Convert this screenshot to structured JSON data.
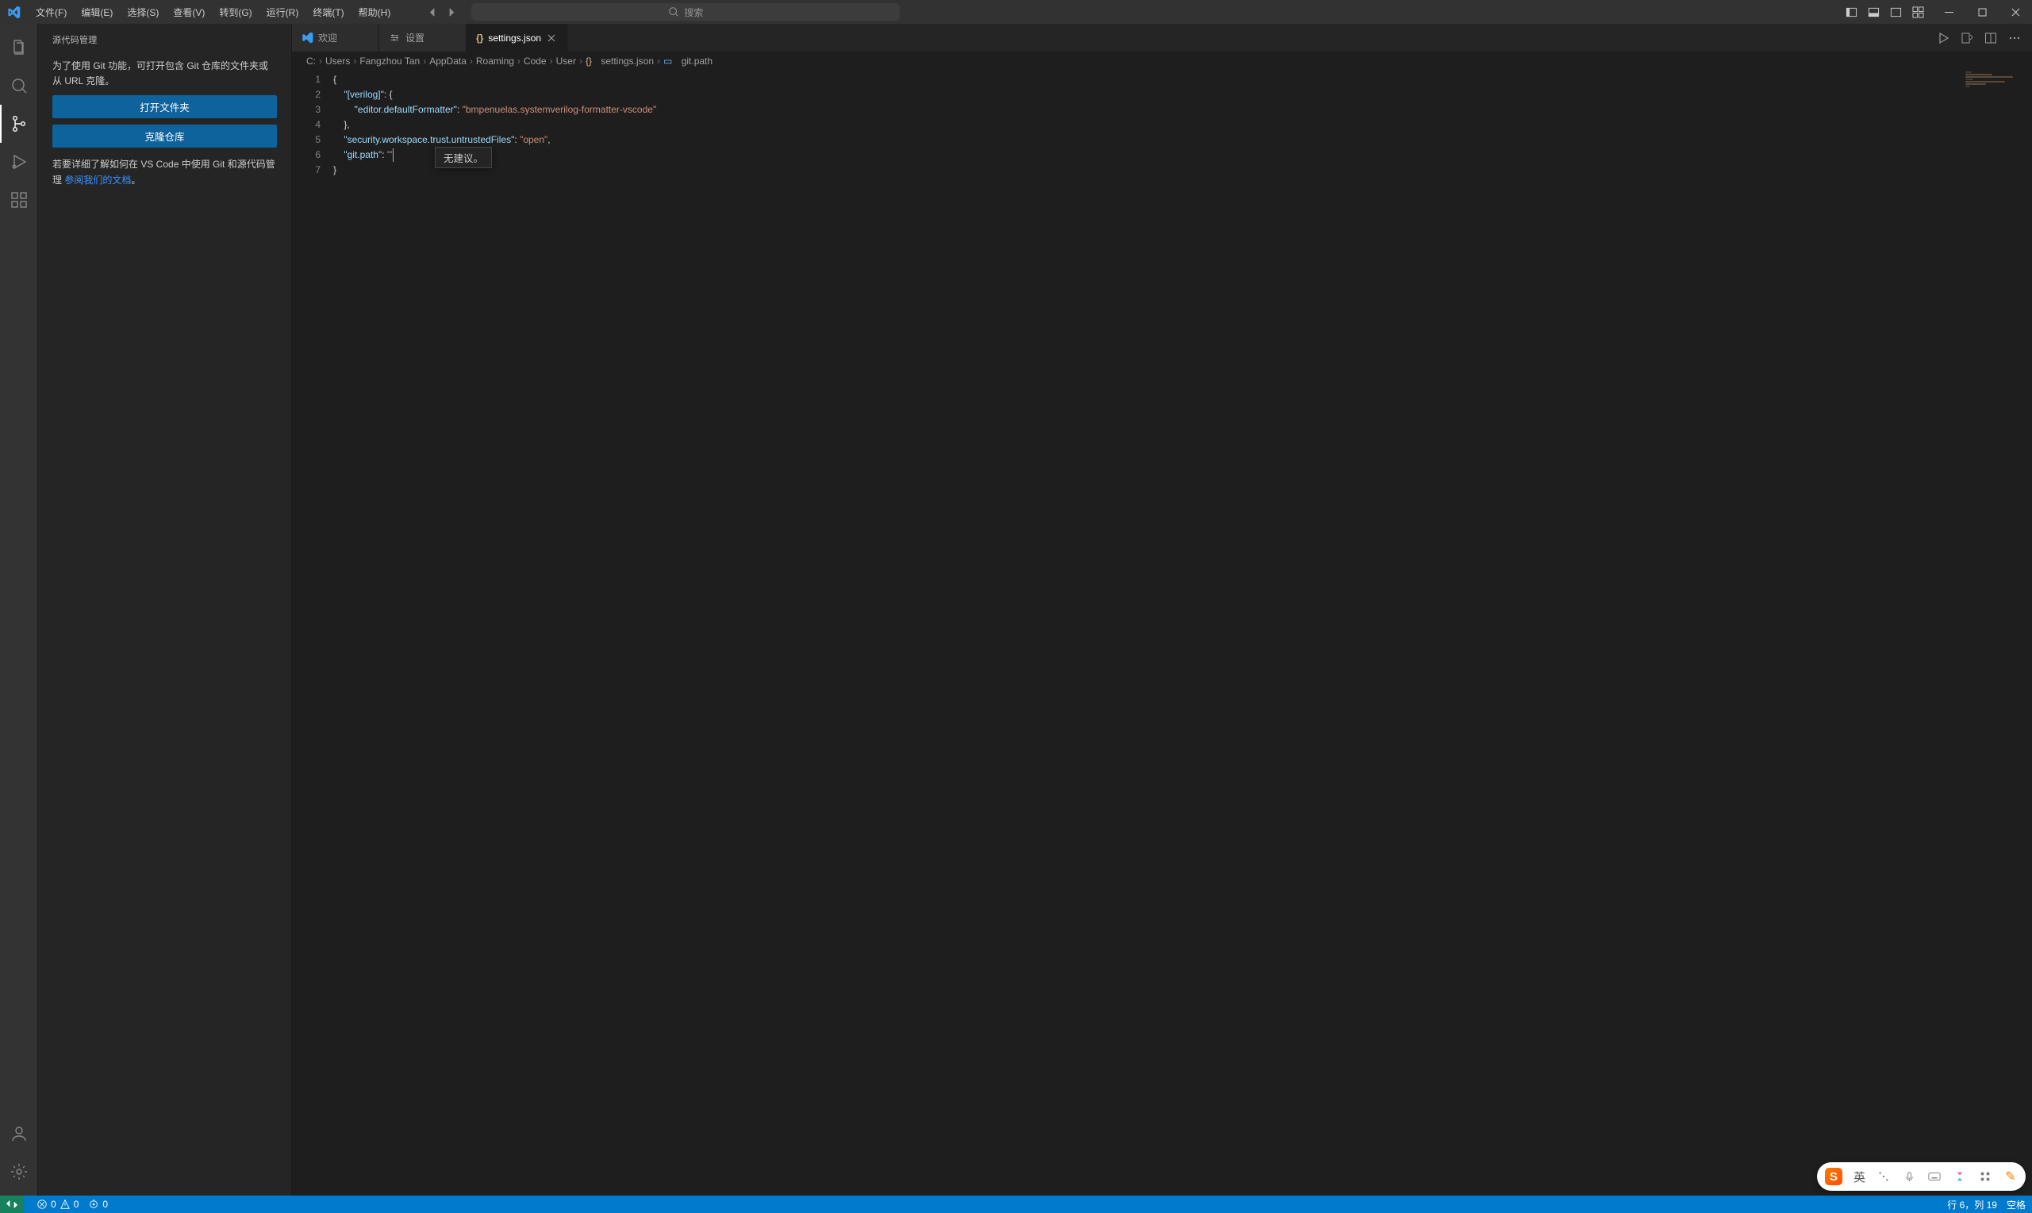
{
  "menubar": {
    "items": [
      "文件(F)",
      "编辑(E)",
      "选择(S)",
      "查看(V)",
      "转到(G)",
      "运行(R)",
      "终端(T)",
      "帮助(H)"
    ]
  },
  "search_placeholder": "搜索",
  "sidebar": {
    "title": "源代码管理",
    "intro": "为了使用 Git 功能，可打开包含 Git 仓库的文件夹或从 URL 克隆。",
    "open_folder_btn": "打开文件夹",
    "clone_repo_btn": "克隆仓库",
    "help_prefix": "若要详细了解如何在 VS Code 中使用 Git 和源代码管理",
    "help_link": "参阅我们的文档",
    "help_suffix": "。"
  },
  "tabs": {
    "welcome": "欢迎",
    "settings": "设置",
    "file": "settings.json"
  },
  "breadcrumbs": [
    "C:",
    "Users",
    "Fangzhou Tan",
    "AppData",
    "Roaming",
    "Code",
    "User",
    "settings.json",
    "git.path"
  ],
  "code": {
    "l1": "{",
    "l2_key": "\"[verilog]\"",
    "l2_rest": ": {",
    "l3_key": "\"editor.defaultFormatter\"",
    "l3_val": "\"bmpenuelas.systemverilog-formatter-vscode\"",
    "l4": "},",
    "l5_key": "\"security.workspace.trust.untrustedFiles\"",
    "l5_val": "\"open\"",
    "l6_key": "\"git.path\"",
    "l6_val": "\"\"",
    "l7": "}"
  },
  "suggest_text": "无建议。",
  "status": {
    "errors": "0",
    "warnings": "0",
    "ports": "0",
    "cursor": "行 6，列 19",
    "spaces": "空格"
  },
  "ime_lang": "英"
}
